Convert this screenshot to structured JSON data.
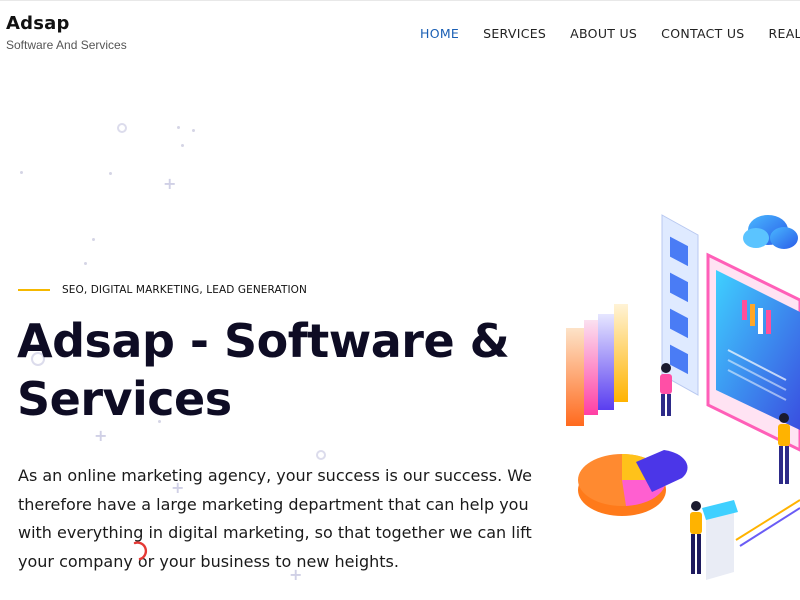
{
  "brand": {
    "name": "Adsap",
    "tagline": "Software And Services"
  },
  "nav": {
    "items": [
      {
        "label": "HOME",
        "active": true
      },
      {
        "label": "SERVICES",
        "active": false
      },
      {
        "label": "ABOUT US",
        "active": false
      },
      {
        "label": "CONTACT US",
        "active": false
      },
      {
        "label": "REAL-ES",
        "active": false
      }
    ]
  },
  "hero": {
    "eyebrow": "SEO, DIGITAL MARKETING, LEAD GENERATION",
    "title": "Adsap - Software & Services",
    "description": "As an online marketing agency, your success is our success. We therefore have a large marketing department that can help you with everything in digital marketing, so that together we can lift your company or your business to new heights."
  },
  "colors": {
    "nav_active": "#1a5fb4",
    "eyebrow_line": "#f5b800",
    "title": "#0e0c24"
  },
  "illustration": {
    "icon": "digital-marketing-isometric-illustration"
  }
}
